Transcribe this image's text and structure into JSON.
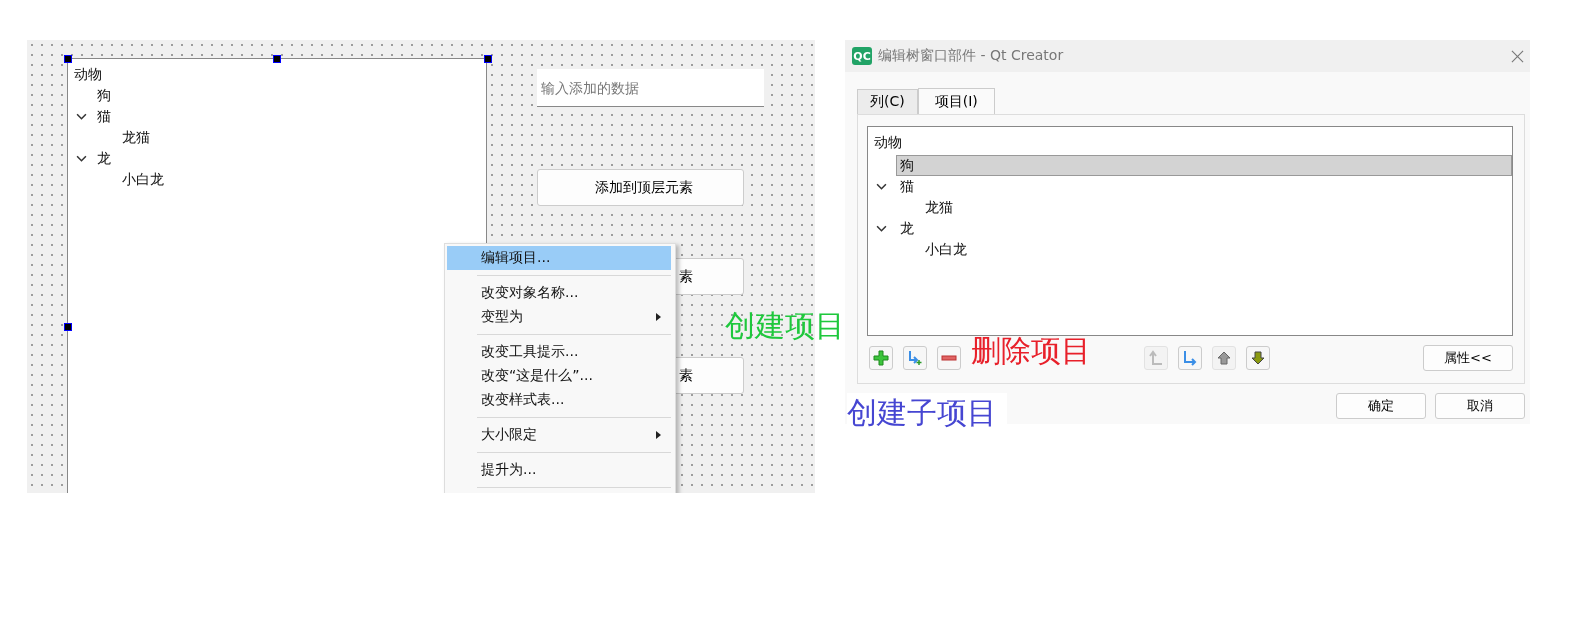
{
  "designer": {
    "tree": {
      "header": "动物",
      "items": [
        {
          "label": "狗"
        },
        {
          "label": "猫",
          "expanded": true,
          "children": [
            {
              "label": "龙猫"
            }
          ]
        },
        {
          "label": "龙",
          "expanded": true,
          "children": [
            {
              "label": "小白龙"
            }
          ]
        }
      ]
    },
    "input": {
      "placeholder": "输入添加的数据"
    },
    "buttons": [
      "添加到顶层元素",
      "素",
      "素"
    ],
    "context_menu": [
      {
        "kind": "item",
        "label": "编辑项目...",
        "selected": true,
        "submenu": false
      },
      {
        "kind": "separator"
      },
      {
        "kind": "item",
        "label": "改变对象名称...",
        "selected": false,
        "submenu": false
      },
      {
        "kind": "item",
        "label": "变型为",
        "selected": false,
        "submenu": true
      },
      {
        "kind": "separator"
      },
      {
        "kind": "item",
        "label": "改变工具提示...",
        "selected": false,
        "submenu": false
      },
      {
        "kind": "item",
        "label": "改变“这是什么”...",
        "selected": false,
        "submenu": false
      },
      {
        "kind": "item",
        "label": "改变样式表...",
        "selected": false,
        "submenu": false
      },
      {
        "kind": "separator"
      },
      {
        "kind": "item",
        "label": "大小限定",
        "selected": false,
        "submenu": true
      },
      {
        "kind": "separator"
      },
      {
        "kind": "item",
        "label": "提升为...",
        "selected": false,
        "submenu": false
      },
      {
        "kind": "separator"
      }
    ]
  },
  "dialog": {
    "logo": "QC",
    "title": "编辑树窗口部件 - Qt Creator",
    "tabs": [
      {
        "label": "列(C)",
        "selected": false
      },
      {
        "label": "项目(I)",
        "selected": true
      }
    ],
    "tree": {
      "header": "动物",
      "items": [
        {
          "label": "狗",
          "selected": true
        },
        {
          "label": "猫",
          "selected": false,
          "expanded": true,
          "children": [
            {
              "label": "龙猫",
              "selected": false
            }
          ]
        },
        {
          "label": "龙",
          "selected": false,
          "expanded": true,
          "children": [
            {
              "label": "小白龙",
              "selected": false
            }
          ]
        }
      ]
    },
    "tools": [
      {
        "kind": "add",
        "disabled": false
      },
      {
        "kind": "add-child",
        "disabled": false
      },
      {
        "kind": "remove",
        "disabled": false
      },
      {
        "kind": "promote",
        "disabled": true
      },
      {
        "kind": "demote",
        "disabled": false
      },
      {
        "kind": "up",
        "disabled": true
      },
      {
        "kind": "down",
        "disabled": false
      }
    ],
    "properties_button": "属性<<",
    "buttons": [
      "确定",
      "取消"
    ]
  },
  "annotations": [
    {
      "text": "创建项目",
      "color": "#1ec83c"
    },
    {
      "text": "删除项目",
      "color": "#e8202a"
    },
    {
      "text": "创建子项目",
      "color": "#4646d2"
    }
  ]
}
